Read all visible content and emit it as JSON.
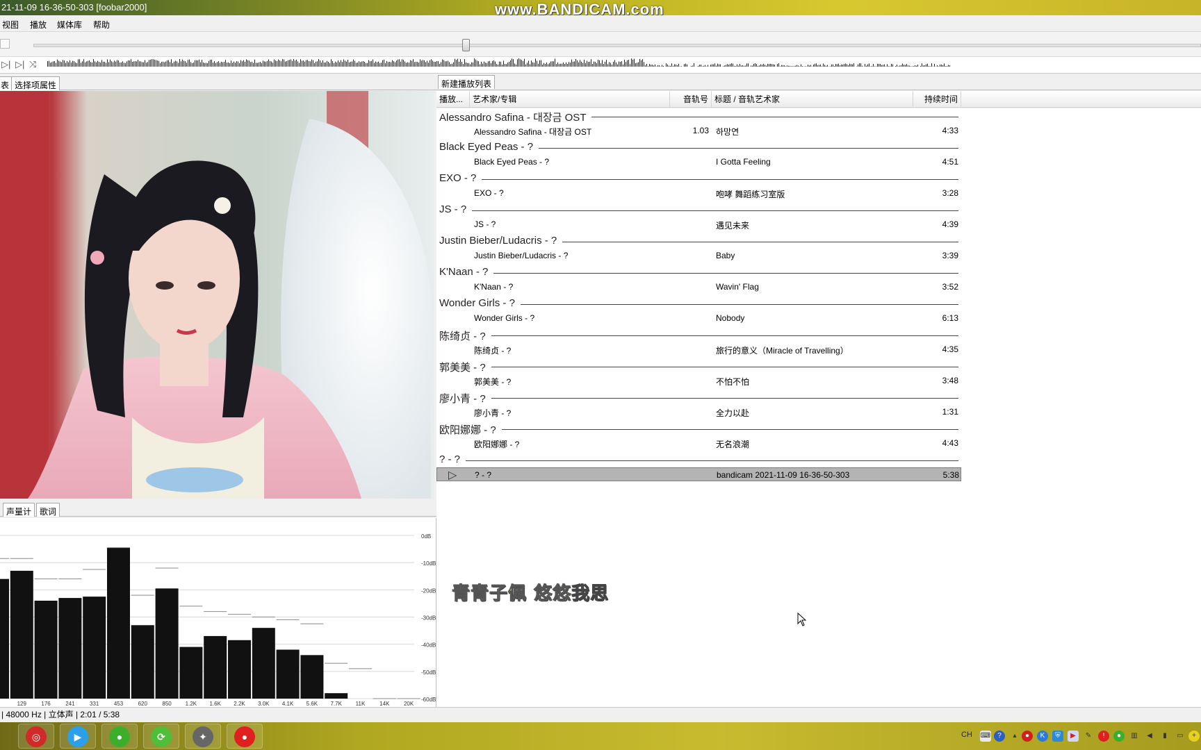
{
  "titlebar": {
    "text": "21-11-09 16-36-50-303  [foobar2000]",
    "watermark": "www.BANDICAM.com"
  },
  "menu": {
    "items": [
      "视图",
      "播放",
      "媒体库",
      "帮助"
    ]
  },
  "seek": {
    "position": 0.37
  },
  "left_panel": {
    "tabs": [
      "表",
      "选择项属性"
    ],
    "vis_tabs": [
      "声量计",
      "歌词"
    ],
    "spectrum": {
      "db_labels": [
        "0dB",
        "-10dB",
        "-20dB",
        "-30dB",
        "-40dB",
        "-50dB",
        "-60dB"
      ],
      "freq_labels": [
        "129",
        "176",
        "241",
        "331",
        "453",
        "620",
        "850",
        "1.2K",
        "1.6K",
        "2.2K",
        "3.0K",
        "4.1K",
        "5.6K",
        "7.7K",
        "11K",
        "14K",
        "20K"
      ],
      "bar_levels_db": [
        -16,
        -13,
        -24,
        -23,
        -22.5,
        -4.5,
        -33,
        -19.5,
        -41,
        -37,
        -38.5,
        -34,
        -42,
        -44,
        -58,
        -60,
        -60,
        -60
      ],
      "peak_levels_db": [
        -8.5,
        -8.5,
        -16,
        -16,
        -12.5,
        -4.5,
        -22,
        -12,
        -26,
        -28,
        -29,
        -30,
        -31,
        -32.5,
        -47,
        -49,
        -60,
        -60
      ]
    }
  },
  "playlist": {
    "tab": "新建播放列表",
    "columns": {
      "playing": "播放...",
      "artist_album": "艺术家/专辑",
      "track_no": "音轨号",
      "title_artist": "标题 / 音轨艺术家",
      "duration": "持续时间"
    },
    "groups": [
      {
        "header": "Alessandro Safina - 대장금 OST",
        "tracks": [
          {
            "artist": "Alessandro Safina - 대장금 OST",
            "no": "1.03",
            "title": "하망연",
            "dur": "4:33"
          }
        ]
      },
      {
        "header": "Black Eyed Peas - ?",
        "tracks": [
          {
            "artist": "Black Eyed Peas - ?",
            "no": "",
            "title": "I Gotta Feeling",
            "dur": "4:51"
          }
        ]
      },
      {
        "header": "EXO - ?",
        "tracks": [
          {
            "artist": "EXO - ?",
            "no": "",
            "title": "咆哮 舞蹈练习室版",
            "dur": "3:28"
          }
        ]
      },
      {
        "header": "JS - ?",
        "tracks": [
          {
            "artist": "JS - ?",
            "no": "",
            "title": "遇见未来",
            "dur": "4:39"
          }
        ]
      },
      {
        "header": "Justin Bieber/Ludacris - ?",
        "tracks": [
          {
            "artist": "Justin Bieber/Ludacris - ?",
            "no": "",
            "title": "Baby",
            "dur": "3:39"
          }
        ]
      },
      {
        "header": "K'Naan - ?",
        "tracks": [
          {
            "artist": "K'Naan - ?",
            "no": "",
            "title": "Wavin' Flag",
            "dur": "3:52"
          }
        ]
      },
      {
        "header": "Wonder Girls - ?",
        "tracks": [
          {
            "artist": "Wonder Girls - ?",
            "no": "",
            "title": "Nobody",
            "dur": "6:13"
          }
        ]
      },
      {
        "header": "陈绮贞 - ?",
        "tracks": [
          {
            "artist": "陈绮贞 - ?",
            "no": "",
            "title": "旅行的意义（Miracle of Travelling）",
            "dur": "4:35"
          }
        ]
      },
      {
        "header": "郭美美 - ?",
        "tracks": [
          {
            "artist": "郭美美 - ?",
            "no": "",
            "title": "不怕不怕",
            "dur": "3:48"
          }
        ]
      },
      {
        "header": "廖小青 - ?",
        "tracks": [
          {
            "artist": "廖小青 - ?",
            "no": "",
            "title": "全力以赴",
            "dur": "1:31"
          }
        ]
      },
      {
        "header": "欧阳娜娜 - ?",
        "tracks": [
          {
            "artist": "欧阳娜娜 - ?",
            "no": "",
            "title": "无名浪潮",
            "dur": "4:43"
          }
        ]
      },
      {
        "header": "? - ?",
        "tracks": [
          {
            "artist": "? - ?",
            "no": "",
            "title": "bandicam 2021-11-09 16-36-50-303",
            "dur": "5:38",
            "playing": true
          }
        ]
      }
    ]
  },
  "lyrics": {
    "sung": "青青子佩 悠悠",
    "unsung": "我思"
  },
  "status": {
    "text": "| 48000 Hz | 立体声 | 2:01 / 5:38"
  },
  "taskbar": {
    "apps": [
      {
        "name": "netease-music",
        "glyph": "◎",
        "color": "#d02a2a"
      },
      {
        "name": "youku",
        "glyph": "▶",
        "color": "#2aa0e8"
      },
      {
        "name": "app-green",
        "glyph": "●",
        "color": "#3cae2c"
      },
      {
        "name": "app-refresh",
        "glyph": "⟳",
        "color": "#4fbf3a"
      },
      {
        "name": "foobar",
        "glyph": "✦",
        "color": "#666666"
      },
      {
        "name": "bandicam",
        "glyph": "●",
        "color": "#e02020"
      }
    ],
    "tray_text": "CH"
  },
  "colors": {
    "playing_row": "#b4b4b4",
    "spectrum_bar": "#111111",
    "lyrics_sung": "#e8e040",
    "lyrics_unsung": "#c040c0"
  }
}
